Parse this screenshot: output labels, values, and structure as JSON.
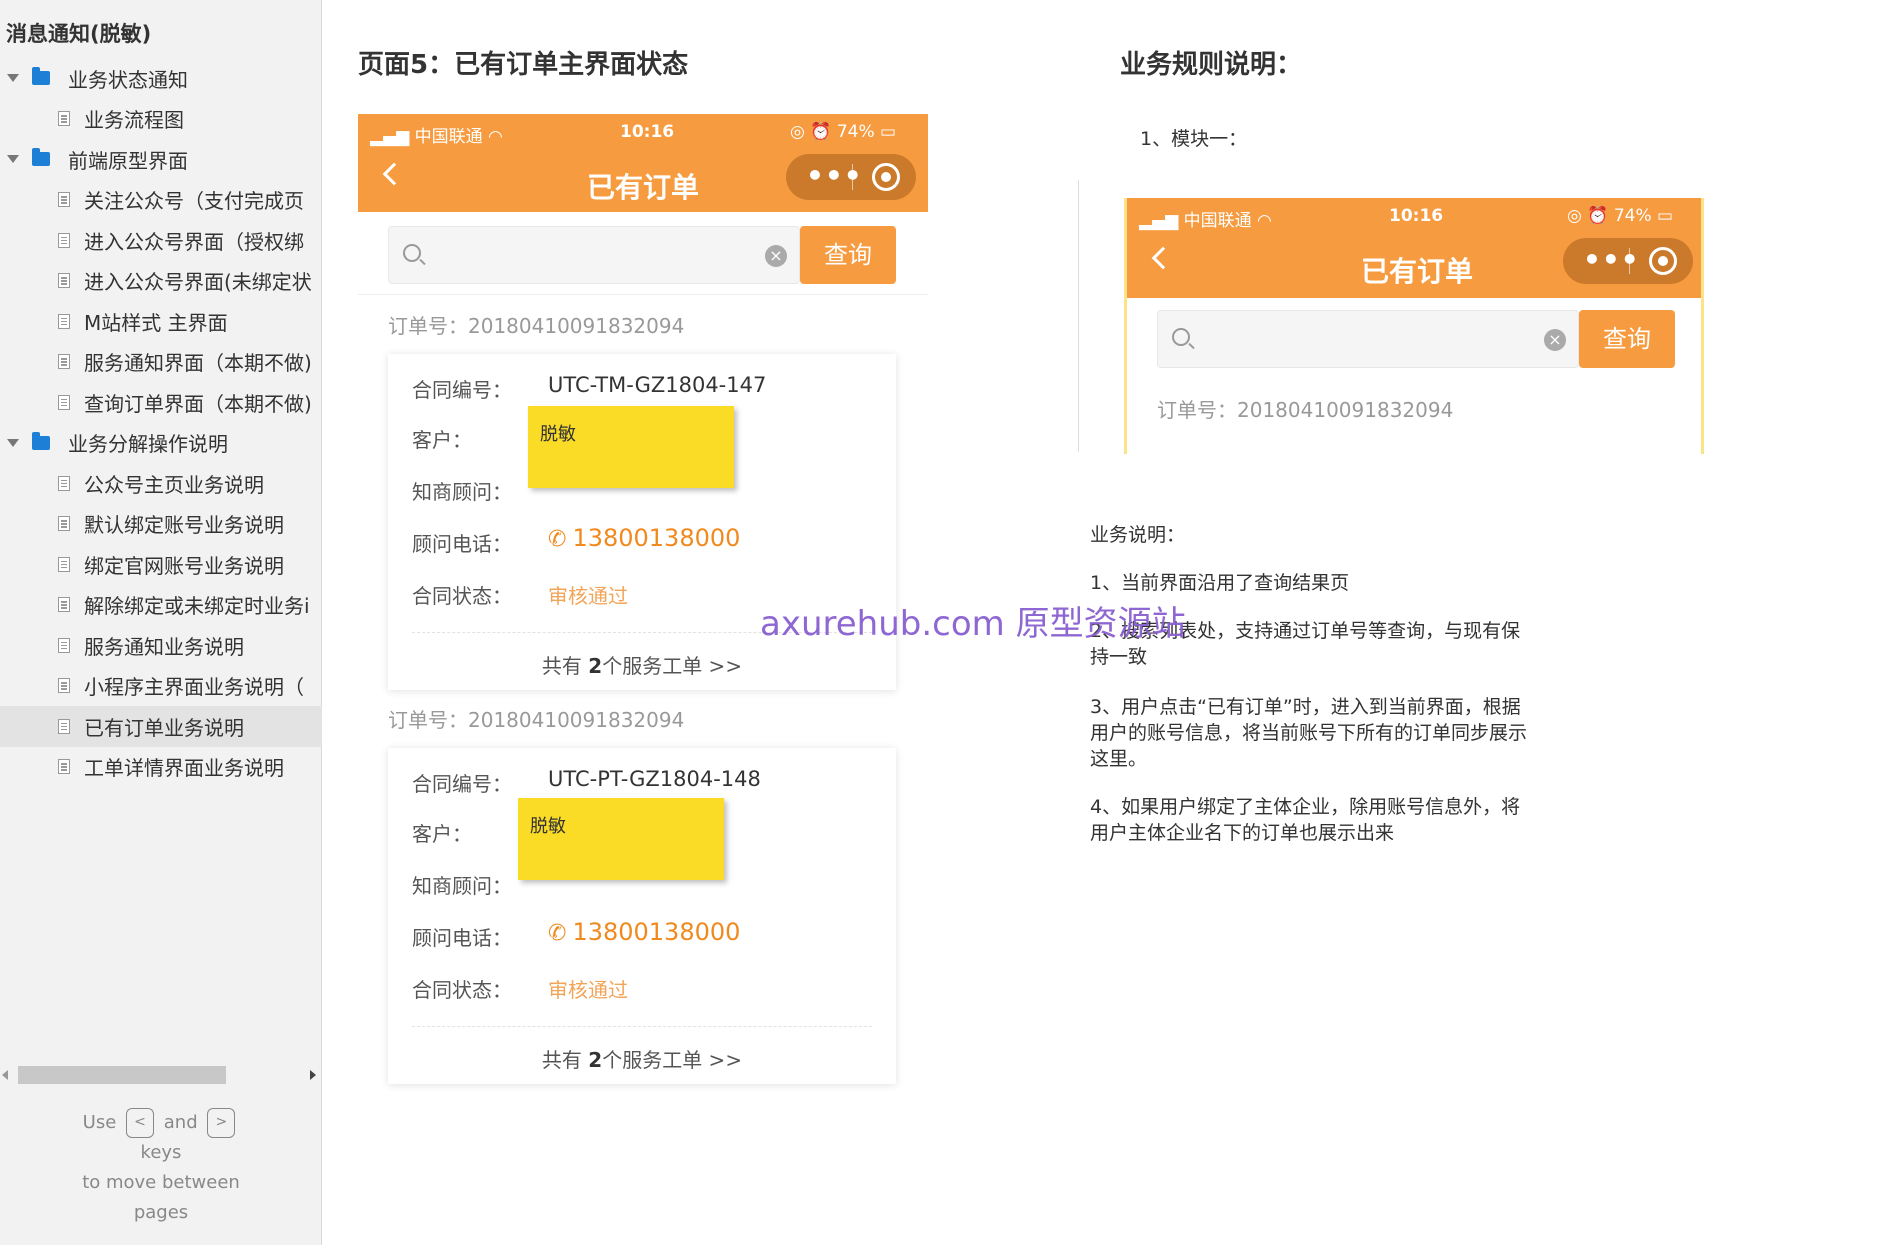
{
  "sidebar": {
    "title": "消息通知(脱敏)",
    "items": [
      {
        "label": "业务状态通知"
      },
      {
        "label": "业务流程图"
      },
      {
        "label": "前端原型界面"
      },
      {
        "label": "关注公众号（支付完成页"
      },
      {
        "label": "进入公众号界面（授权绑"
      },
      {
        "label": "进入公众号界面(未绑定状"
      },
      {
        "label": "M站样式 主界面"
      },
      {
        "label": "服务通知界面（本期不做)"
      },
      {
        "label": "查询订单界面（本期不做)"
      },
      {
        "label": "业务分解操作说明"
      },
      {
        "label": "公众号主页业务说明"
      },
      {
        "label": "默认绑定账号业务说明"
      },
      {
        "label": "绑定官网账号业务说明"
      },
      {
        "label": "解除绑定或未绑定时业务i"
      },
      {
        "label": "服务通知业务说明"
      },
      {
        "label": "小程序主界面业务说明（"
      },
      {
        "label": "已有订单业务说明"
      },
      {
        "label": "工单详情界面业务说明"
      }
    ],
    "key_hint": {
      "use": "Use",
      "prev_key": "<",
      "and": "and",
      "next_key": ">",
      "keys": "keys",
      "move1": "to move between",
      "move2": "pages"
    }
  },
  "main": {
    "left_heading": "页面5：已有订单主界面状态",
    "right_heading": "业务规则说明：",
    "module_label": "1、模块一：",
    "watermark": "axurehub.com 原型资源站"
  },
  "phone": {
    "carrier": "中国联通",
    "time": "10:16",
    "battery": "74%",
    "nav_title": "已有订单",
    "query_button": "查询",
    "orders": [
      {
        "order_no": "订单号：20180410091832094",
        "contract_label": "合同编号：",
        "contract_no": "UTC-TM-GZ1804-147",
        "customer_label": "客户：",
        "advisor_label": "知商顾问：",
        "phone_label": "顾问电话：",
        "phone": "13800138000",
        "status_label": "合同状态：",
        "status": "审核通过",
        "sticky": "脱敏",
        "footer_pre": "共有 ",
        "footer_num": "2",
        "footer_post": "个服务工单 >>"
      },
      {
        "order_no": "订单号：20180410091832094",
        "contract_label": "合同编号：",
        "contract_no": "UTC-PT-GZ1804-148",
        "customer_label": "客户：",
        "advisor_label": "知商顾问：",
        "phone_label": "顾问电话：",
        "phone": "13800138000",
        "status_label": "合同状态：",
        "status": "审核通过",
        "sticky": "脱敏",
        "footer_pre": "共有 ",
        "footer_num": "2",
        "footer_post": "个服务工单 >>"
      }
    ]
  },
  "mini": {
    "carrier": "中国联通",
    "time": "10:16",
    "battery": "74%",
    "nav_title": "已有订单",
    "query_button": "查询",
    "order_no": "订单号：20180410091832094"
  },
  "description": {
    "title": "业务说明：",
    "p1": "1、当前界面沿用了查询结果页",
    "p2a": "2、搜索列表处，支持通过订单号等查询，与现有保",
    "p2b": "持一致",
    "p3a": "3、用户点击“已有订单”时，进入到当前界面，根据",
    "p3b": "用户的账号信息，将当前账号下所有的订单同步展示",
    "p3c": "这里。",
    "p4a": "4、如果用户绑定了主体企业，除用账号信息外，将",
    "p4b": "用户主体企业名下的订单也展示出来"
  },
  "colors": {
    "accent_orange": "#f69b3f",
    "phone_orange": "#f08a1e",
    "sticky_yellow": "#fadc26",
    "folder_blue": "#1e7fd6",
    "watermark_purple": "#8a5fd0"
  }
}
